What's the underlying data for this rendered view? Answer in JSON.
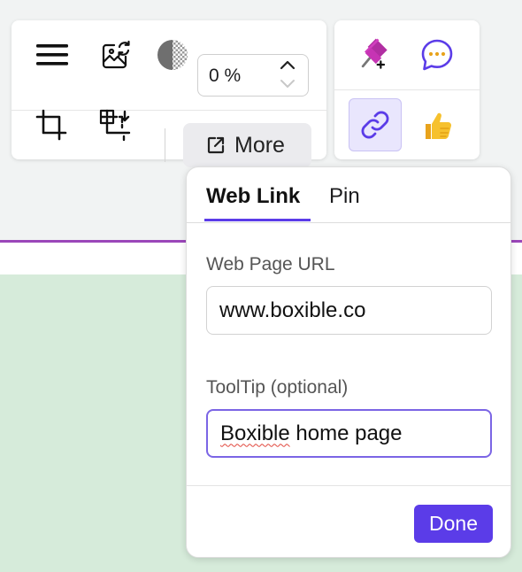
{
  "toolbar": {
    "opacity_value": "0 %",
    "more_label": "More",
    "icons": [
      "menu-icon",
      "image-refresh-icon",
      "opacity-icon",
      "crop-icon",
      "transform-icon",
      "external-link-icon"
    ]
  },
  "toolbar2": {
    "icons": [
      "pushpin-add-icon",
      "chat-bubble-icon",
      "link-icon",
      "thumbs-up-icon"
    ],
    "link_active": true
  },
  "popup": {
    "tabs": [
      {
        "label": "Web Link",
        "active": true
      },
      {
        "label": "Pin",
        "active": false
      }
    ],
    "url_label": "Web Page URL",
    "url_value": "www.boxible.co",
    "tooltip_label": "ToolTip (optional)",
    "tooltip_value_misspelled": "Boxible",
    "tooltip_value_rest": " home page",
    "done_label": "Done"
  },
  "colors": {
    "accent": "#5b3ce8",
    "page_bg": "#f1f3f3",
    "green_area": "#d6ebda",
    "divider_purple": "#9b47b9"
  }
}
